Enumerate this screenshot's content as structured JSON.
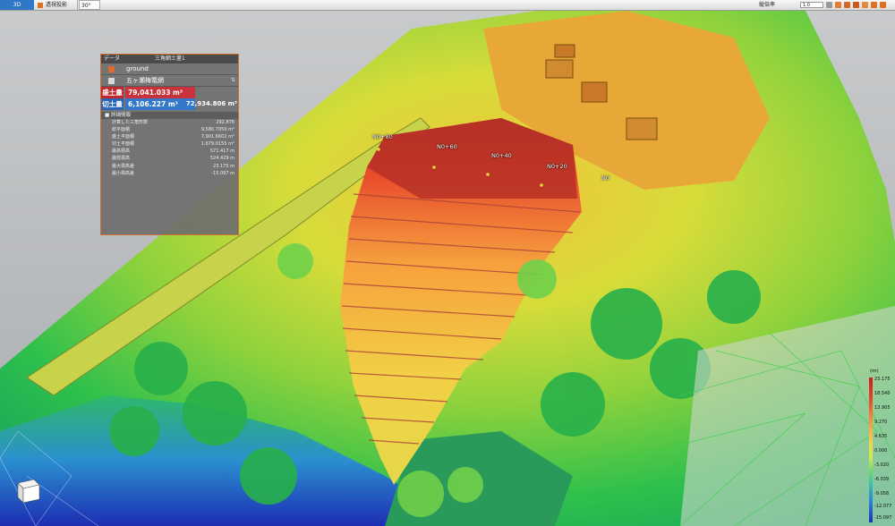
{
  "toolbar": {
    "mode_3d": "3D",
    "projection": "透視投影",
    "angle": "30°",
    "exaggeration_label": "縦倍率",
    "exaggeration_value": "1.0"
  },
  "panel": {
    "header_left": "データ",
    "header_title": "三角網土量1",
    "layer1": "ground",
    "layer2": "五ヶ瀬梅篭網",
    "fill_label": "盛土量",
    "fill_value": "79,041.033 m³",
    "cut_label": "切土量",
    "cut_value": "6,106.227 m³",
    "total_value": "72,934.806 m³",
    "section_title": "詳細情報",
    "stats": [
      {
        "key": "計算した三角形数",
        "value": "292,876"
      },
      {
        "key": "総平面積",
        "value": "9,580.7050 m²"
      },
      {
        "key": "盛土平面積",
        "value": "7,901.6602 m²"
      },
      {
        "key": "切土平面積",
        "value": "1,679.0155 m²"
      },
      {
        "key": "最高標高",
        "value": "571.417 m"
      },
      {
        "key": "最低標高",
        "value": "524.429 m"
      },
      {
        "key": "最大標高差",
        "value": "23.175 m"
      },
      {
        "key": "最小標高差",
        "value": "-15.097 m"
      }
    ]
  },
  "stations": [
    "N0+80",
    "N0+60",
    "N0+40",
    "N0+20",
    "N0"
  ],
  "legend": {
    "unit": "(m)",
    "ticks": [
      "23.175",
      "18.540",
      "13.905",
      "9.270",
      "4.635",
      "0.000",
      "-3.020",
      "-6.039",
      "-9.058",
      "-12.077",
      "-15.097"
    ]
  }
}
